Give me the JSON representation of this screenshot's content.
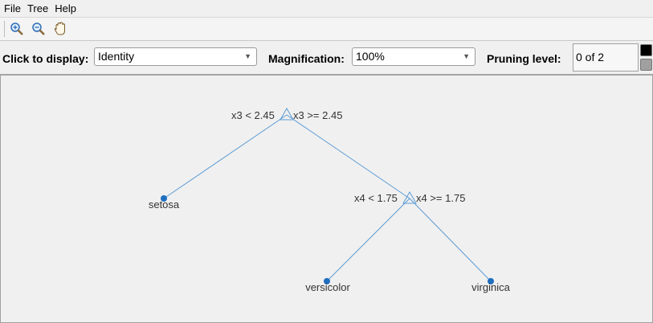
{
  "menubar": {
    "items": [
      "File",
      "Tree",
      "Help"
    ]
  },
  "toolbar": {
    "icons": [
      "zoom-in-icon",
      "zoom-out-icon",
      "pan-hand-icon"
    ]
  },
  "controls": {
    "display_label": "Click to display:",
    "display_value": "Identity",
    "magnification_label": "Magnification:",
    "magnification_value": "100%",
    "pruning_label": "Pruning level:",
    "pruning_value": "0 of 2"
  },
  "tree": {
    "root": {
      "left_rule": "x3 < 2.45",
      "right_rule": "x3 >= 2.45"
    },
    "node2": {
      "left_rule": "x4 < 1.75",
      "right_rule": "x4 >= 1.75"
    },
    "leaves": [
      "setosa",
      "versicolor",
      "virginica"
    ]
  },
  "colors": {
    "line": "#5b9bd5",
    "leaf": "#1f6fbf",
    "text": "#333333"
  }
}
